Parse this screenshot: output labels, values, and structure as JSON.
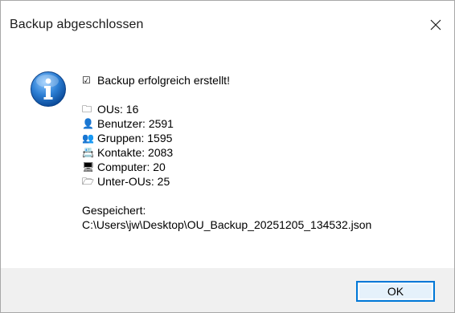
{
  "window": {
    "title": "Backup abgeschlossen",
    "close_glyph": "✕"
  },
  "message": {
    "headline_icon": "☑",
    "headline": "Backup erfolgreich erstellt!",
    "stats": [
      {
        "icon": "🗀",
        "text": "OUs: 16"
      },
      {
        "icon": "👤",
        "text": "Benutzer: 2591"
      },
      {
        "icon": "👥",
        "text": "Gruppen: 1595"
      },
      {
        "icon": "📇",
        "text": "Kontakte: 2083"
      },
      {
        "icon": "🖥",
        "text": "Computer: 20"
      },
      {
        "icon": "🗁",
        "text": "Unter-OUs: 25"
      }
    ],
    "saved_label": "Gespeichert:",
    "saved_path": "C:\\Users\\jw\\Desktop\\OU_Backup_20251205_134532.json"
  },
  "buttons": {
    "ok_label": "OK"
  },
  "colors": {
    "accent": "#0078d7",
    "footer_bg": "#f0f0f0",
    "info_icon": "#2b6fb8"
  }
}
